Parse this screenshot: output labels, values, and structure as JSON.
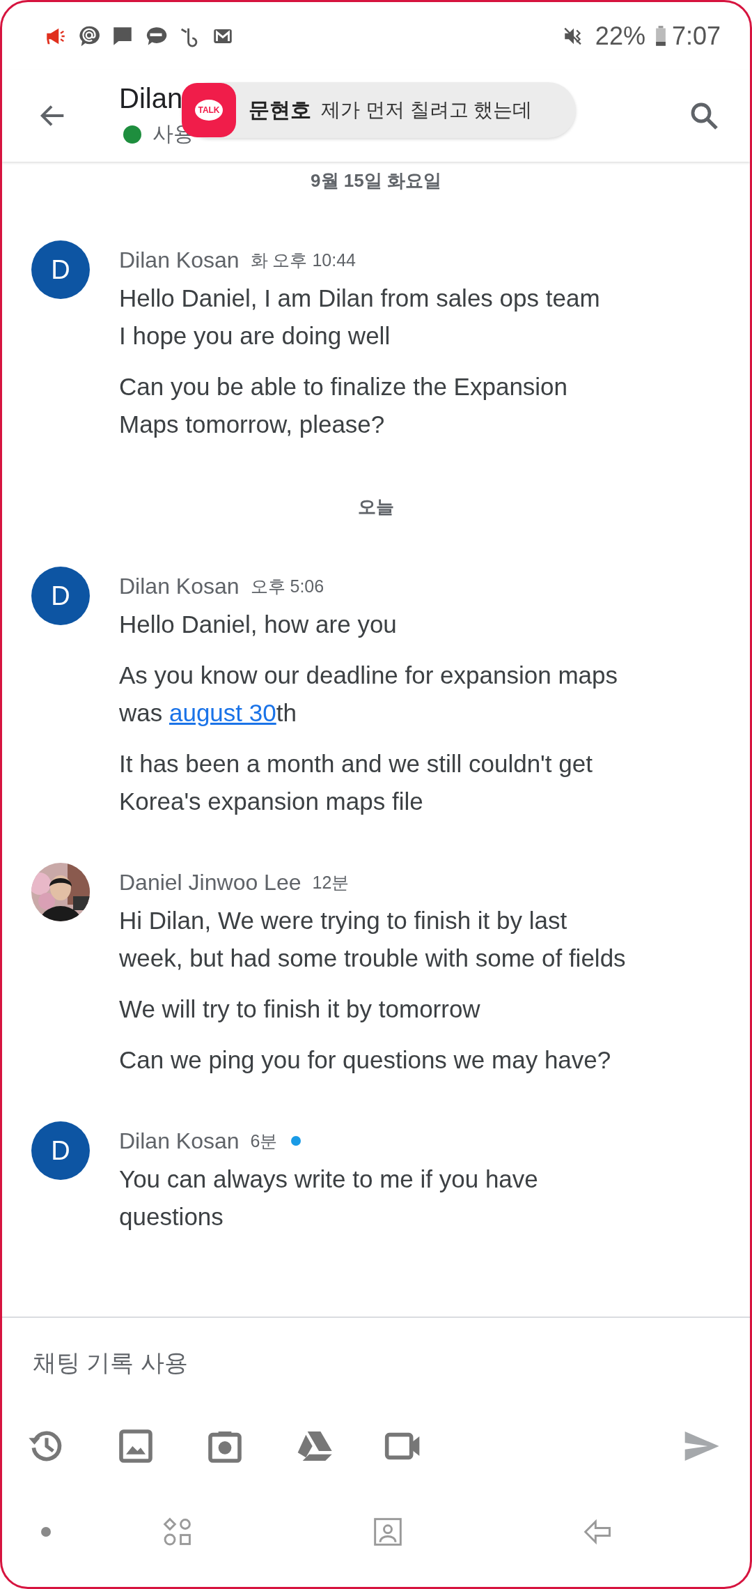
{
  "status_bar": {
    "battery": "22%",
    "time": "7:07"
  },
  "header": {
    "title": "Dilan",
    "status": "사용",
    "online": true
  },
  "toast": {
    "app_icon": "TALK",
    "sender": "문현호",
    "message": "제가 먼저 칠려고 했는데"
  },
  "feed": [
    {
      "kind": "date",
      "label": "9월 15일 화요일"
    },
    {
      "kind": "message",
      "sender": "Dilan Kosan",
      "time": "화 오후 10:44",
      "unread": false,
      "avatar": {
        "kind": "letter",
        "letter": "D"
      },
      "paragraphs": [
        [
          {
            "text": "Hello Daniel, I am Dilan from sales ops team\nI hope you are doing well"
          }
        ],
        [
          {
            "text": "Can you be able to finalize the Expansion Maps tomorrow, please?"
          }
        ]
      ]
    },
    {
      "kind": "date",
      "label": "오늘"
    },
    {
      "kind": "message",
      "sender": "Dilan Kosan",
      "time": "오후 5:06",
      "unread": false,
      "avatar": {
        "kind": "letter",
        "letter": "D"
      },
      "paragraphs": [
        [
          {
            "text": "Hello Daniel, how are you"
          }
        ],
        [
          {
            "text": "As you know our deadline for expansion maps was "
          },
          {
            "text": "august 30",
            "kind": "link"
          },
          {
            "text": "th"
          }
        ],
        [
          {
            "text": "It has been a month and we still couldn't get Korea's expansion maps file"
          }
        ]
      ]
    },
    {
      "kind": "message",
      "sender": "Daniel Jinwoo Lee",
      "time": "12분",
      "unread": false,
      "avatar": {
        "kind": "picture"
      },
      "paragraphs": [
        [
          {
            "text": "Hi Dilan, We were trying to finish it by last week, but had some trouble with some of fields"
          }
        ],
        [
          {
            "text": "We will try to finish it by tomorrow"
          }
        ],
        [
          {
            "text": "Can we ping you for questions we may have?"
          }
        ]
      ]
    },
    {
      "kind": "message",
      "sender": "Dilan Kosan",
      "time": "6분",
      "unread": true,
      "avatar": {
        "kind": "letter",
        "letter": "D"
      },
      "paragraphs": [
        [
          {
            "text": "You can always write to me if you have questions"
          }
        ]
      ]
    }
  ],
  "composer": {
    "placeholder": "채팅 기록 사용"
  }
}
